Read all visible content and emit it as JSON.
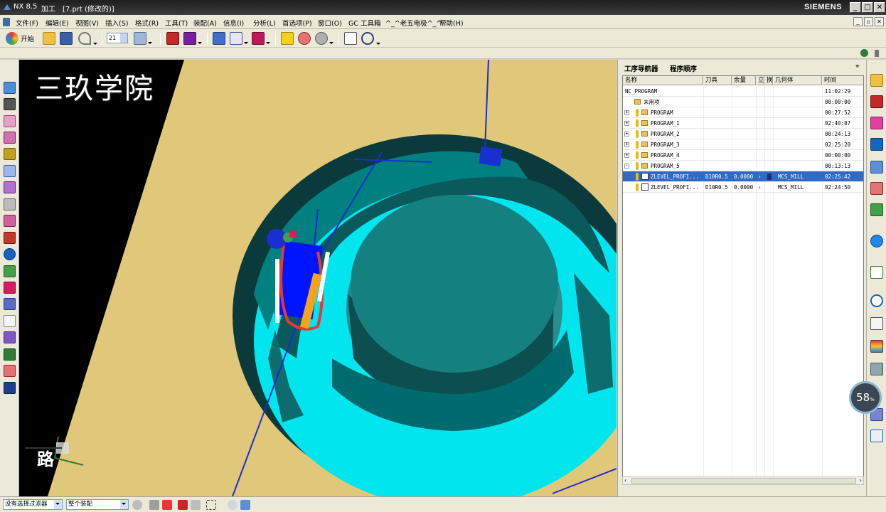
{
  "titlebar": {
    "app_name": "NX 8.5",
    "module": "加工",
    "document": "[7.prt (修改的)]",
    "brand": "SIEMENS",
    "buttons": [
      "minimize",
      "restore",
      "close"
    ]
  },
  "menubar": {
    "items": [
      "文件(F)",
      "编辑(E)",
      "视图(V)",
      "插入(S)",
      "格式(R)",
      "工具(T)",
      "装配(A)",
      "信息(I)",
      "分析(L)",
      "首选项(P)",
      "窗口(O)",
      "GC 工具箱",
      "^_^老五电极^_^",
      "帮助(H)"
    ]
  },
  "toolbar": {
    "start_label": "开始",
    "layer_value": "21"
  },
  "viewport": {
    "watermark": "三玖学院",
    "road_label": "路"
  },
  "navigator": {
    "tabs": [
      "工序导航器",
      "程序顺序"
    ],
    "pin_icon": "pin-icon",
    "columns": [
      "名称",
      "刀具",
      "余量",
      "立",
      "换",
      "几何体",
      "时间"
    ],
    "rows": [
      {
        "name": "NC_PROGRAM",
        "tool": "",
        "stock": "",
        "geometry": "",
        "time": "11:02:29",
        "kind": "root",
        "indent": 0
      },
      {
        "name": "未用项",
        "tool": "",
        "stock": "",
        "geometry": "",
        "time": "00:00:00",
        "kind": "folder",
        "indent": 1
      },
      {
        "name": "PROGRAM",
        "tool": "",
        "stock": "",
        "geometry": "",
        "time": "00:27:52",
        "kind": "program",
        "indent": 1
      },
      {
        "name": "PROGRAM_1",
        "tool": "",
        "stock": "",
        "geometry": "",
        "time": "02:40:07",
        "kind": "program",
        "indent": 1
      },
      {
        "name": "PROGRAM_2",
        "tool": "",
        "stock": "",
        "geometry": "",
        "time": "00:24:13",
        "kind": "program",
        "indent": 1
      },
      {
        "name": "PROGRAM_3",
        "tool": "",
        "stock": "",
        "geometry": "",
        "time": "02:25:20",
        "kind": "program",
        "indent": 1
      },
      {
        "name": "PROGRAM_4",
        "tool": "",
        "stock": "",
        "geometry": "",
        "time": "00:00:00",
        "kind": "program",
        "indent": 1
      },
      {
        "name": "PROGRAM_5",
        "tool": "",
        "stock": "",
        "geometry": "",
        "time": "00:13:13",
        "kind": "program",
        "indent": 1
      },
      {
        "name": "ZLEVEL_PROFI...",
        "tool": "D10R0.5",
        "stock": "0.0000",
        "geometry": "MCS_MILL",
        "time": "02:25:42",
        "kind": "operation",
        "indent": 2,
        "selected": true
      },
      {
        "name": "ZLEVEL_PROFI...",
        "tool": "D10R0.5",
        "stock": "0.0000",
        "geometry": "MCS_MILL",
        "time": "02:24:50",
        "kind": "operation",
        "indent": 2,
        "selected": false
      }
    ]
  },
  "progress": {
    "value": 58,
    "unit": "%"
  },
  "statusbar": {
    "filter_value": "没有选择过滤器",
    "scope_value": "整个装配"
  },
  "colors": {
    "viewport_bg": "#e1c77a",
    "part_cyan": "#00e5ee",
    "part_teal": "#008080",
    "selection_blue": "#316ac5"
  }
}
